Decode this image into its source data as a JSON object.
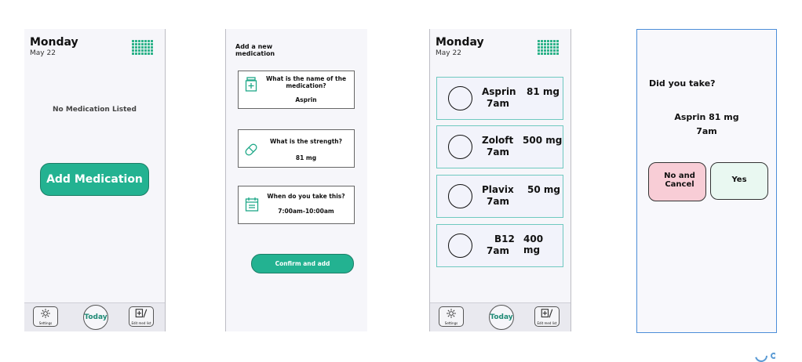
{
  "screen1": {
    "day": "Monday",
    "date": "May 22",
    "empty_message": "No Medication Listed",
    "add_button": "Add Medication"
  },
  "nav": {
    "settings_label": "Settings",
    "today_label": "Today",
    "edit_label": "Edit med list"
  },
  "screen2": {
    "title": "Add a new medication",
    "name_question": "What is the name of the medication?",
    "name_value": "Asprin",
    "strength_question": "What is the strength?",
    "strength_value": "81 mg",
    "time_question": "When do you take this?",
    "time_value": "7:00am-10:00am",
    "confirm_button": "Confirm and add"
  },
  "screen3": {
    "day": "Monday",
    "date": "May 22",
    "medications": [
      {
        "name": "Asprin",
        "strength": "81 mg",
        "time": "7am"
      },
      {
        "name": "Zoloft",
        "strength": "500 mg",
        "time": "7am"
      },
      {
        "name": "Plavix",
        "strength": "50 mg",
        "time": "7am"
      },
      {
        "name": "B12",
        "strength": "400 mg",
        "time": "7am"
      }
    ]
  },
  "screen4": {
    "question": "Did you take?",
    "med_line": "Asprin 81 mg",
    "time_line": "7am",
    "no_button": "No and Cancel",
    "yes_button": "Yes",
    "no_color": "#f8cdd6",
    "yes_color": "#e9f8f1"
  },
  "colors": {
    "accent": "#23b291",
    "card_border": "#6fc9c0"
  }
}
